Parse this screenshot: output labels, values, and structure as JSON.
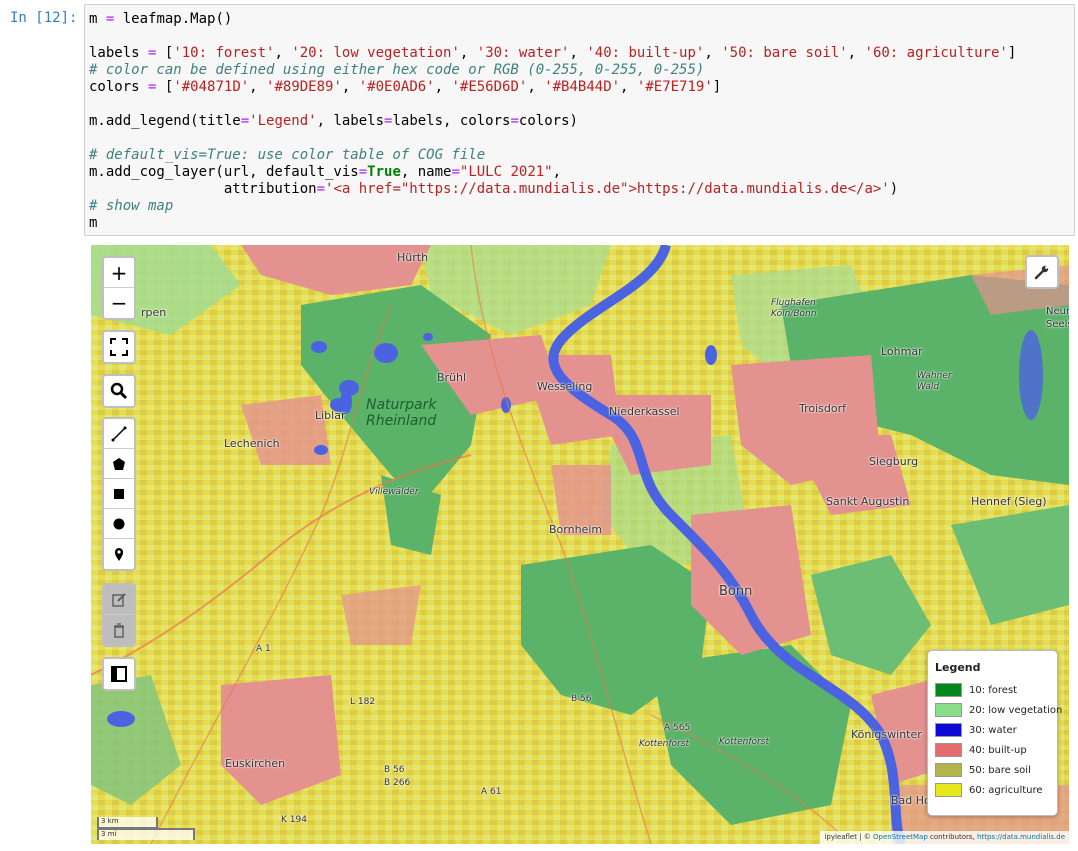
{
  "notebook": {
    "prompt": "In [12]:",
    "code": {
      "line1": [
        "m ",
        "=",
        " leafmap.Map()"
      ],
      "labels_var": "labels",
      "labels_items": [
        "'10: forest'",
        "'20: low vegetation'",
        "'30: water'",
        "'40: built-up'",
        "'50: bare soil'",
        "'60: agriculture'"
      ],
      "comment1": "# color can be defined using either hex code or RGB (0-255, 0-255, 0-255)",
      "colors_var": "colors",
      "colors_items": [
        "'#04871D'",
        "'#89DE89'",
        "'#0E0AD6'",
        "'#E56D6D'",
        "'#B4B44D'",
        "'#E7E719'"
      ],
      "legend_call_a": "m.add_legend(title",
      "legend_title_str": "'Legend'",
      "legend_call_b": ", labels",
      "legend_call_c": "labels, colors",
      "legend_call_d": "colors)",
      "comment2": "# default_vis=True: use color table of COG file",
      "cog_a": "m.add_cog_layer(url, default_vis",
      "cog_true": "True",
      "cog_b": ", name",
      "cog_name": "\"LULC 2021\"",
      "cog_c": ",",
      "attr_a": "                attribution",
      "attr_str": "'<a href=\"https://data.mundialis.de\">https://data.mundialis.de</a>'",
      "attr_b": ")",
      "comment3": "# show map",
      "last": "m"
    }
  },
  "map": {
    "controls": {
      "zoom_in": "+",
      "zoom_out": "−",
      "fullscreen_icon": "fullscreen-icon",
      "search_icon": "search-icon",
      "draw_tools": [
        "polyline-icon",
        "polygon-icon",
        "rectangle-icon",
        "circle-icon",
        "marker-icon",
        "edit-icon",
        "delete-icon"
      ],
      "layer_icon": "layers-icon",
      "wrench_icon": "wrench-icon"
    },
    "places": {
      "hurth": "Hürth",
      "bruhl": "Brühl",
      "wesseling": "Wesseling",
      "niederkassel": "Niederkassel",
      "troisdorf": "Troisdorf",
      "lohmar": "Lohmar",
      "siegburg": "Siegburg",
      "sankt_augustin": "Sankt Augustin",
      "hennef": "Hennef (Sieg)",
      "bornheim": "Bornheim",
      "bonn": "Bonn",
      "liblar": "Liblar",
      "lechenich": "Lechenich",
      "euskirchen": "Euskirchen",
      "konigswinter": "Königswinter",
      "bad_honnef": "Bad Ho",
      "kerpen": "rpen",
      "ville": "Villewälder",
      "kottenforst1": "Kottenforst",
      "kottenforst2": "Kottenforst",
      "wahner": "Wahner\nWald",
      "flughafen": "Flughafen\nKöln/Bonn",
      "neunk": "Neunk\nSeels"
    },
    "park_label_1": "Naturpark",
    "park_label_2": "Rheinland",
    "roads": {
      "a1": "A 1",
      "a61": "A 61",
      "a565": "A 565",
      "b56": "B 56",
      "b56b": "B 56",
      "b266": "B 266",
      "l182": "L 182",
      "k194": "K 194"
    },
    "legend": {
      "title": "Legend",
      "items": [
        {
          "label": "10: forest",
          "color": "#04871D"
        },
        {
          "label": "20: low vegetation",
          "color": "#89DE89"
        },
        {
          "label": "30: water",
          "color": "#0E0AD6"
        },
        {
          "label": "40: built-up",
          "color": "#E56D6D"
        },
        {
          "label": "50: bare soil",
          "color": "#B4B44D"
        },
        {
          "label": "60: agriculture",
          "color": "#E7E719"
        }
      ]
    },
    "scale_km": "3 km",
    "scale_mi": "3 mi",
    "attribution": {
      "a": "ipyleaflet | © ",
      "osm": "OpenStreetMap",
      "b": " contributors, ",
      "mundialis": "https://data.mundialis.de"
    }
  }
}
